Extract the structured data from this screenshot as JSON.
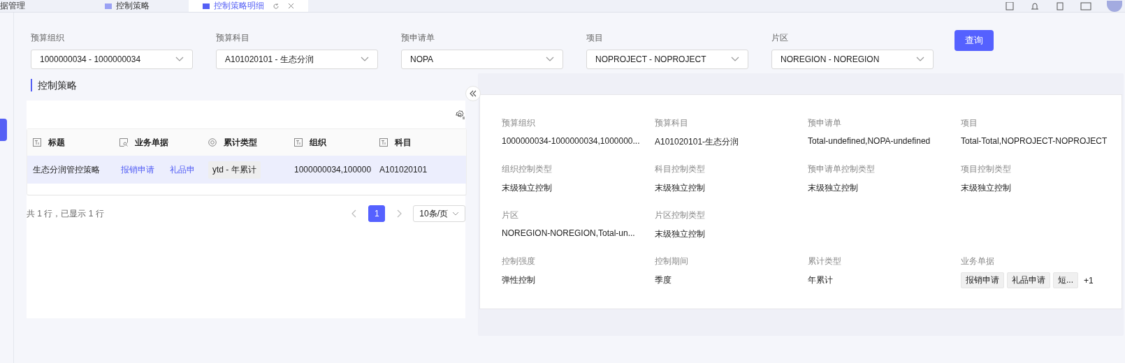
{
  "tabs": [
    {
      "label": "据管理",
      "selected": false,
      "icon": false
    },
    {
      "label": "控制策略",
      "selected": false,
      "icon": true
    },
    {
      "label": "控制策略明细",
      "selected": true,
      "icon": true
    }
  ],
  "filters": [
    {
      "label": "预算组织",
      "value": "1000000034 - 1000000034"
    },
    {
      "label": "预算科目",
      "value": "A101020101 - 生态分润"
    },
    {
      "label": "预申请单",
      "value": "NOPA"
    },
    {
      "label": "项目",
      "value": "NOPROJECT - NOPROJECT"
    },
    {
      "label": "片区",
      "value": "NOREGION - NOREGION"
    }
  ],
  "query_button": "查询",
  "section_title": "控制策略",
  "table": {
    "columns": [
      {
        "label": "标题",
        "kind": "text"
      },
      {
        "label": "业务单据",
        "kind": "document"
      },
      {
        "label": "累计类型",
        "kind": "option"
      },
      {
        "label": "组织",
        "kind": "text"
      },
      {
        "label": "科目",
        "kind": "text"
      }
    ],
    "rows": [
      {
        "selected": true,
        "title": "生态分润管控策略",
        "documents": [
          "报销申请",
          "礼品申"
        ],
        "accumulation": "ytd - 年累计",
        "organization": "1000000034,100000",
        "subject": "A101020101"
      }
    ]
  },
  "pagination": {
    "summary": "共 1 行，已显示 1 行",
    "pages": [
      {
        "label": "1",
        "selected": true
      }
    ],
    "page_size": "10条/页"
  },
  "detail_rows": [
    [
      {
        "label": "预算组织",
        "value": "1000000034-1000000034,1000000..."
      },
      {
        "label": "预算科目",
        "value": "A101020101-生态分润"
      },
      {
        "label": "预申请单",
        "value": "Total-undefined,NOPA-undefined"
      },
      {
        "label": "项目",
        "value": "Total-Total,NOPROJECT-NOPROJECT"
      }
    ],
    [
      {
        "label": "组织控制类型",
        "value": "末级独立控制"
      },
      {
        "label": "科目控制类型",
        "value": "末级独立控制"
      },
      {
        "label": "预申请单控制类型",
        "value": "末级独立控制"
      },
      {
        "label": "项目控制类型",
        "value": "末级独立控制"
      }
    ],
    [
      {
        "label": "片区",
        "value": "NOREGION-NOREGION,Total-un..."
      },
      {
        "label": "片区控制类型",
        "value": "末级独立控制"
      }
    ],
    [
      {
        "label": "控制强度",
        "value": "弹性控制"
      },
      {
        "label": "控制期间",
        "value": "季度"
      },
      {
        "label": "累计类型",
        "value": "年累计"
      },
      {
        "label": "业务单据",
        "tags": [
          "报销申请",
          "礼品申请",
          "短..."
        ],
        "more": "+1"
      }
    ]
  ]
}
